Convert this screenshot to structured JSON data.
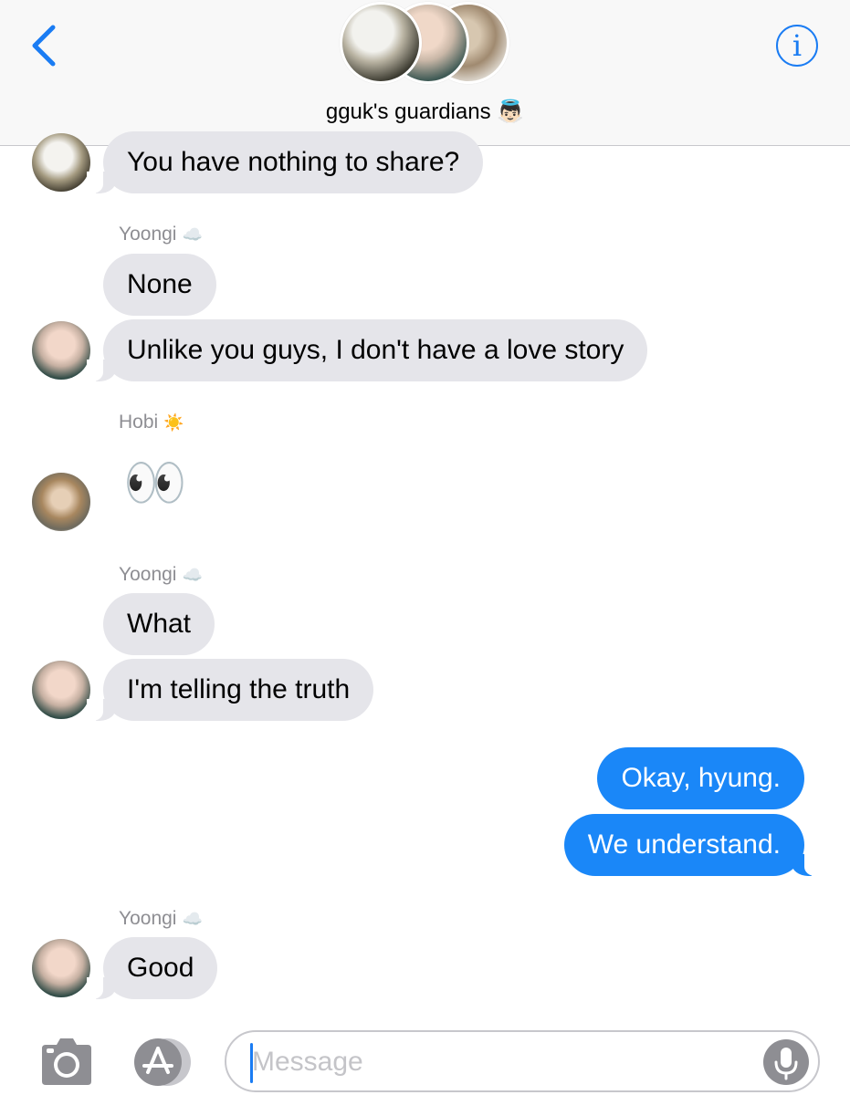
{
  "header": {
    "group_name": "gguk's guardians",
    "group_emoji": "👼🏻",
    "info_label": "i"
  },
  "messages": {
    "m1": {
      "text": "You have nothing to share?"
    },
    "yoongi_label_1": {
      "name": "Yoongi",
      "emoji": "☁️"
    },
    "m2": {
      "text": "None"
    },
    "m3": {
      "text": "Unlike you guys, I don't have a love story"
    },
    "hobi_label": {
      "name": "Hobi",
      "emoji": "☀️"
    },
    "m4": {
      "text": "👀"
    },
    "yoongi_label_2": {
      "name": "Yoongi",
      "emoji": "☁️"
    },
    "m5": {
      "text": "What"
    },
    "m6": {
      "text": "I'm telling the truth"
    },
    "m7": {
      "text": "Okay, hyung."
    },
    "m8": {
      "text": "We understand."
    },
    "yoongi_label_3": {
      "name": "Yoongi",
      "emoji": "☁️"
    },
    "m9": {
      "text": "Good"
    }
  },
  "compose": {
    "placeholder": "Message",
    "value": ""
  },
  "colors": {
    "accent": "#1a7cf3",
    "outgoing_bubble": "#1a87f8",
    "incoming_bubble": "#e5e5ea"
  },
  "icons": [
    "back-chevron-icon",
    "info-icon",
    "camera-icon",
    "app-store-icon",
    "microphone-icon"
  ]
}
